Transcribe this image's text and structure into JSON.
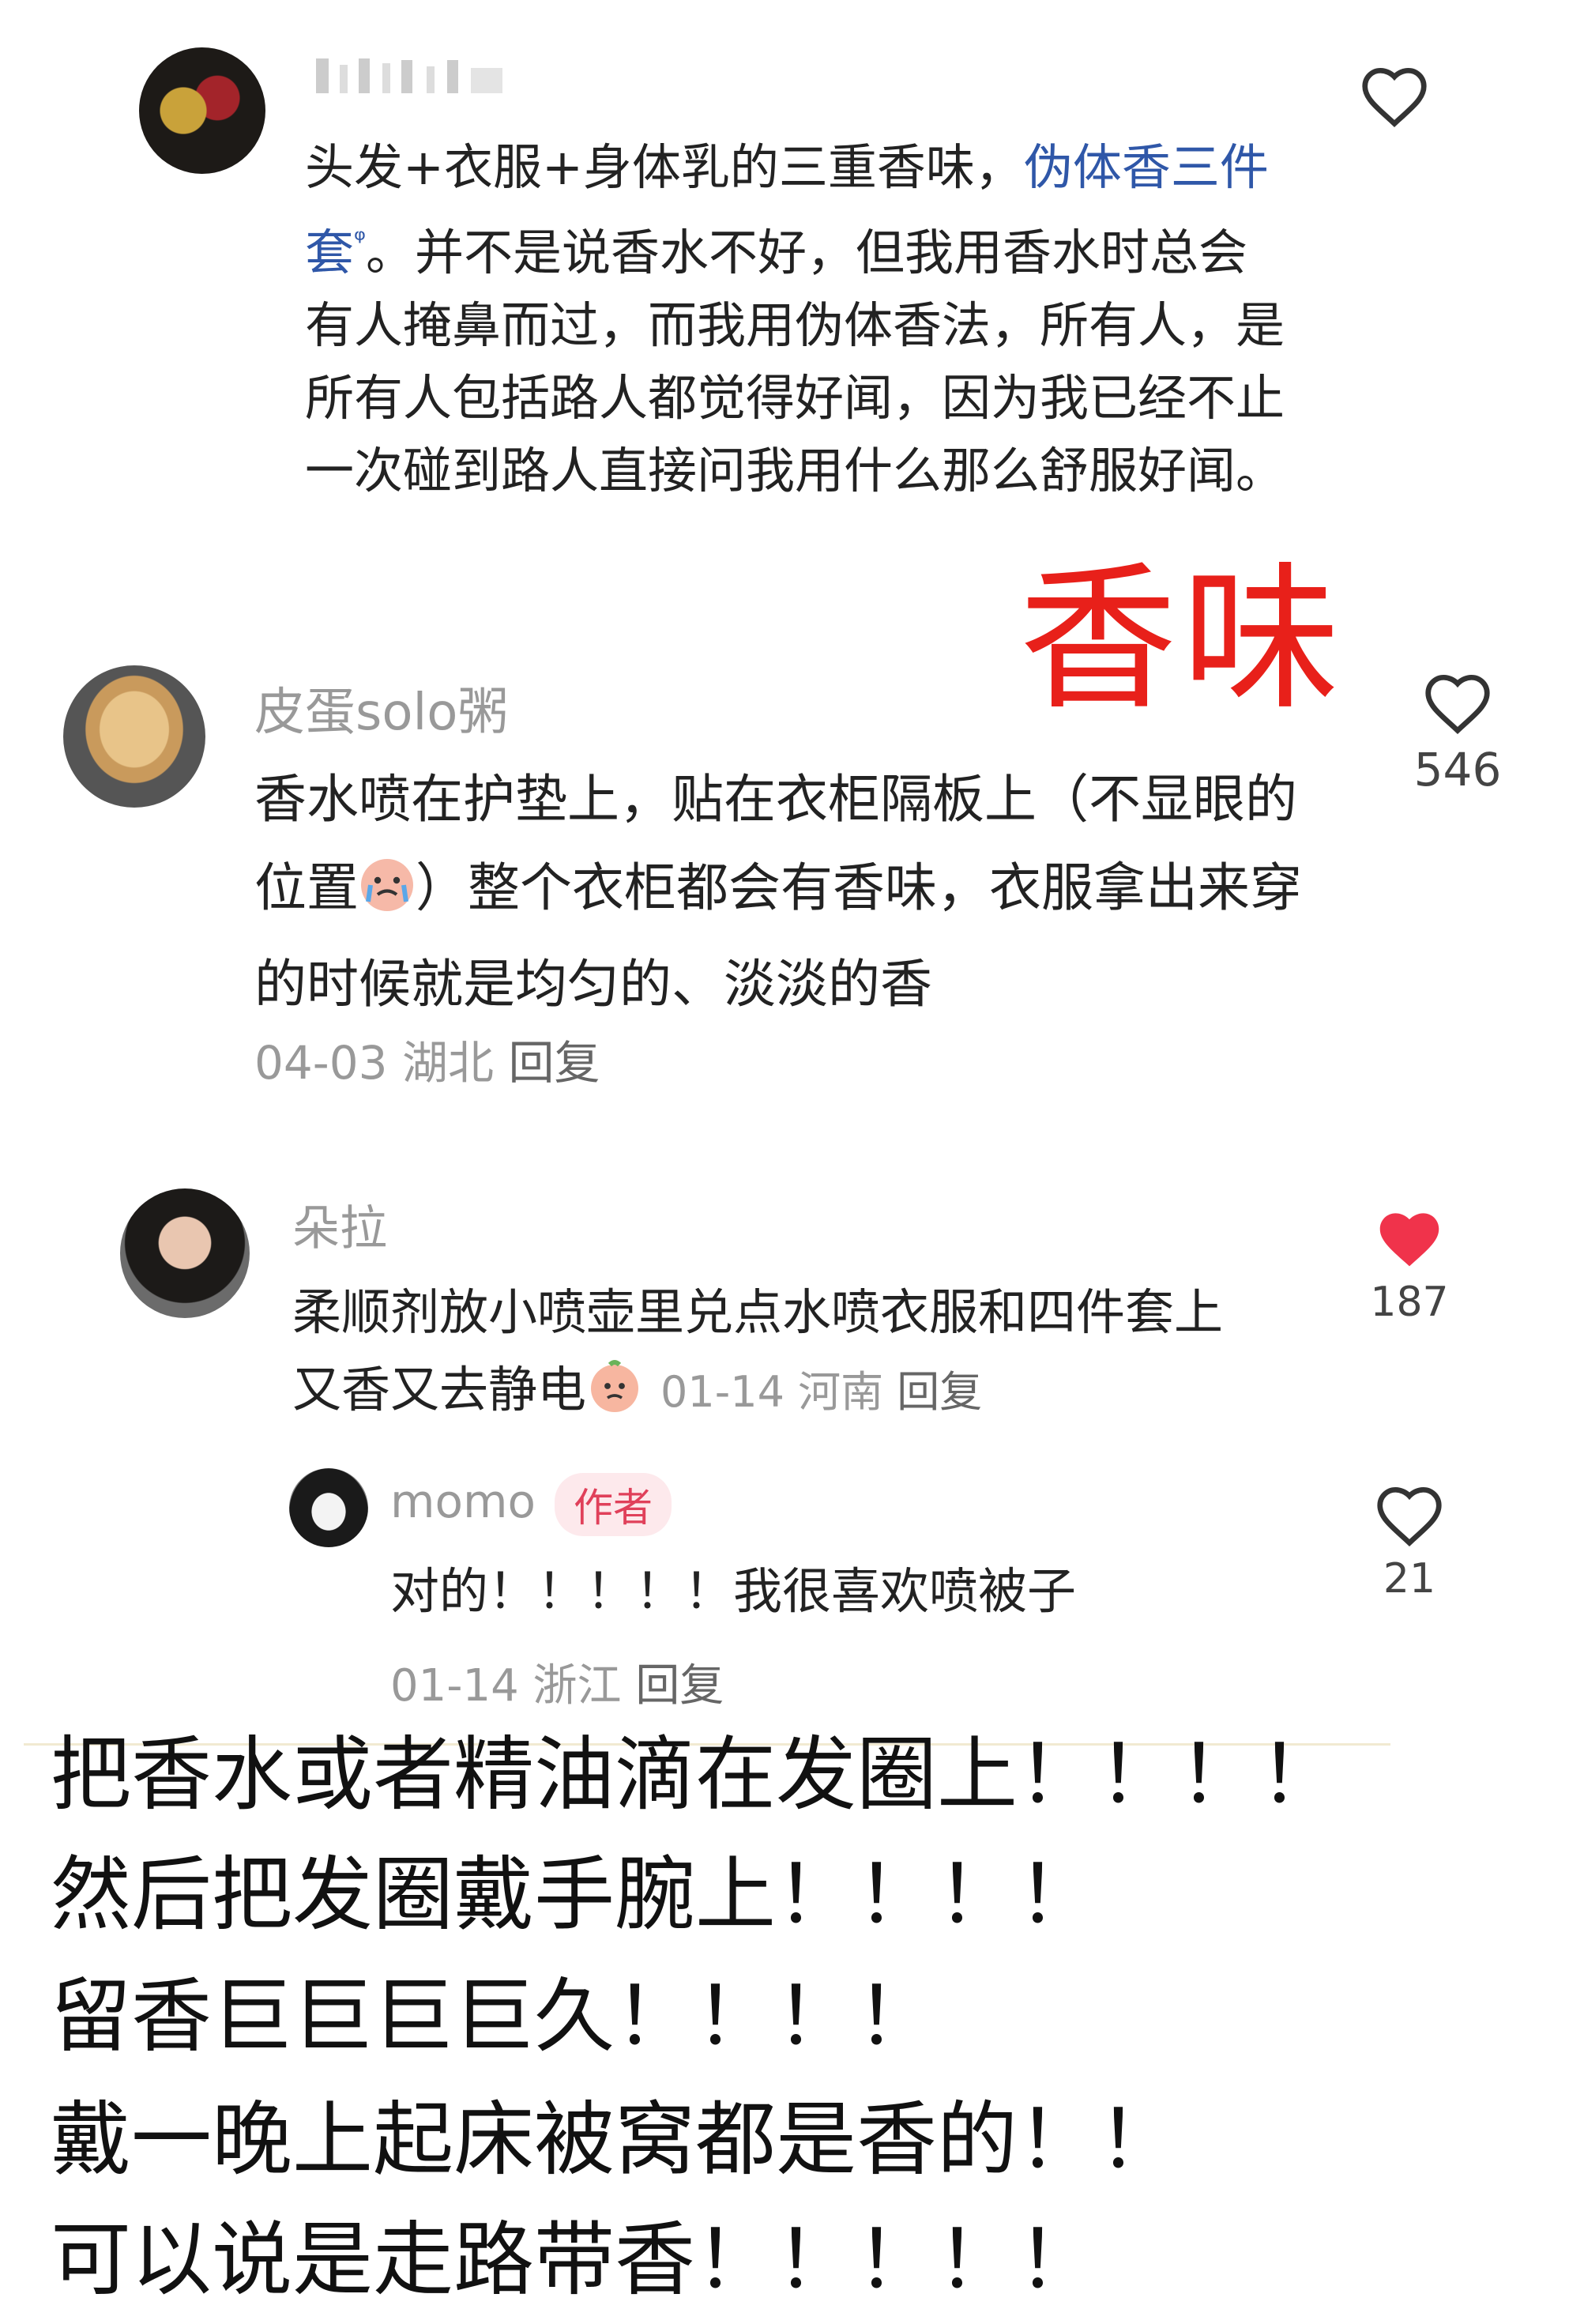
{
  "comments": [
    {
      "username": "▌▌▌▌▌▌",
      "text_part1": "头发+衣服+身体乳的三重香味，",
      "link_text": "伪体香三件套",
      "text_part2": "。并不是说香水不好，但我用香水时总会有人掩鼻而过，而我用伪体香法，所有人，是所有人包括路人都觉得好闻，因为我已经不止一次碰到路人直接问我用什么那么舒服好闻。",
      "liked": false
    },
    {
      "username": "皮蛋solo粥",
      "text_part1": "香水喷在护垫上，贴在衣柜隔板上（不显眼的位置",
      "text_part2": "）整个衣柜都会有香味，衣服拿出来穿的时候就是均匀的、淡淡的香",
      "date": "04-03",
      "location": "湖北",
      "reply_label": "回复",
      "like_count": "546",
      "liked": false
    },
    {
      "username": "朵拉",
      "text": "柔顺剂放小喷壶里兑点水喷衣服和四件套上又香又去静电",
      "date": "01-14",
      "location": "河南",
      "reply_label": "回复",
      "like_count": "187",
      "liked": true
    },
    {
      "username": "momo",
      "badge": "作者",
      "text": "对的！！！！！我很喜欢喷被子",
      "date": "01-14",
      "location": "浙江",
      "reply_label": "回复",
      "like_count": "21",
      "liked": false
    }
  ],
  "annotation": "香味",
  "overlay_lines": [
    "把香水或者精油滴在发圈上！！！！",
    "然后把发圈戴手腕上！！！！",
    "留香巨巨巨巨久！！！！",
    "戴一晚上起床被窝都是香的！！",
    "可以说是走路带香！！！！！"
  ],
  "colors": {
    "liked_heart": "#f0334b",
    "link": "#2f57a8",
    "annotation": "#e8201a",
    "meta_gray": "#999999"
  }
}
